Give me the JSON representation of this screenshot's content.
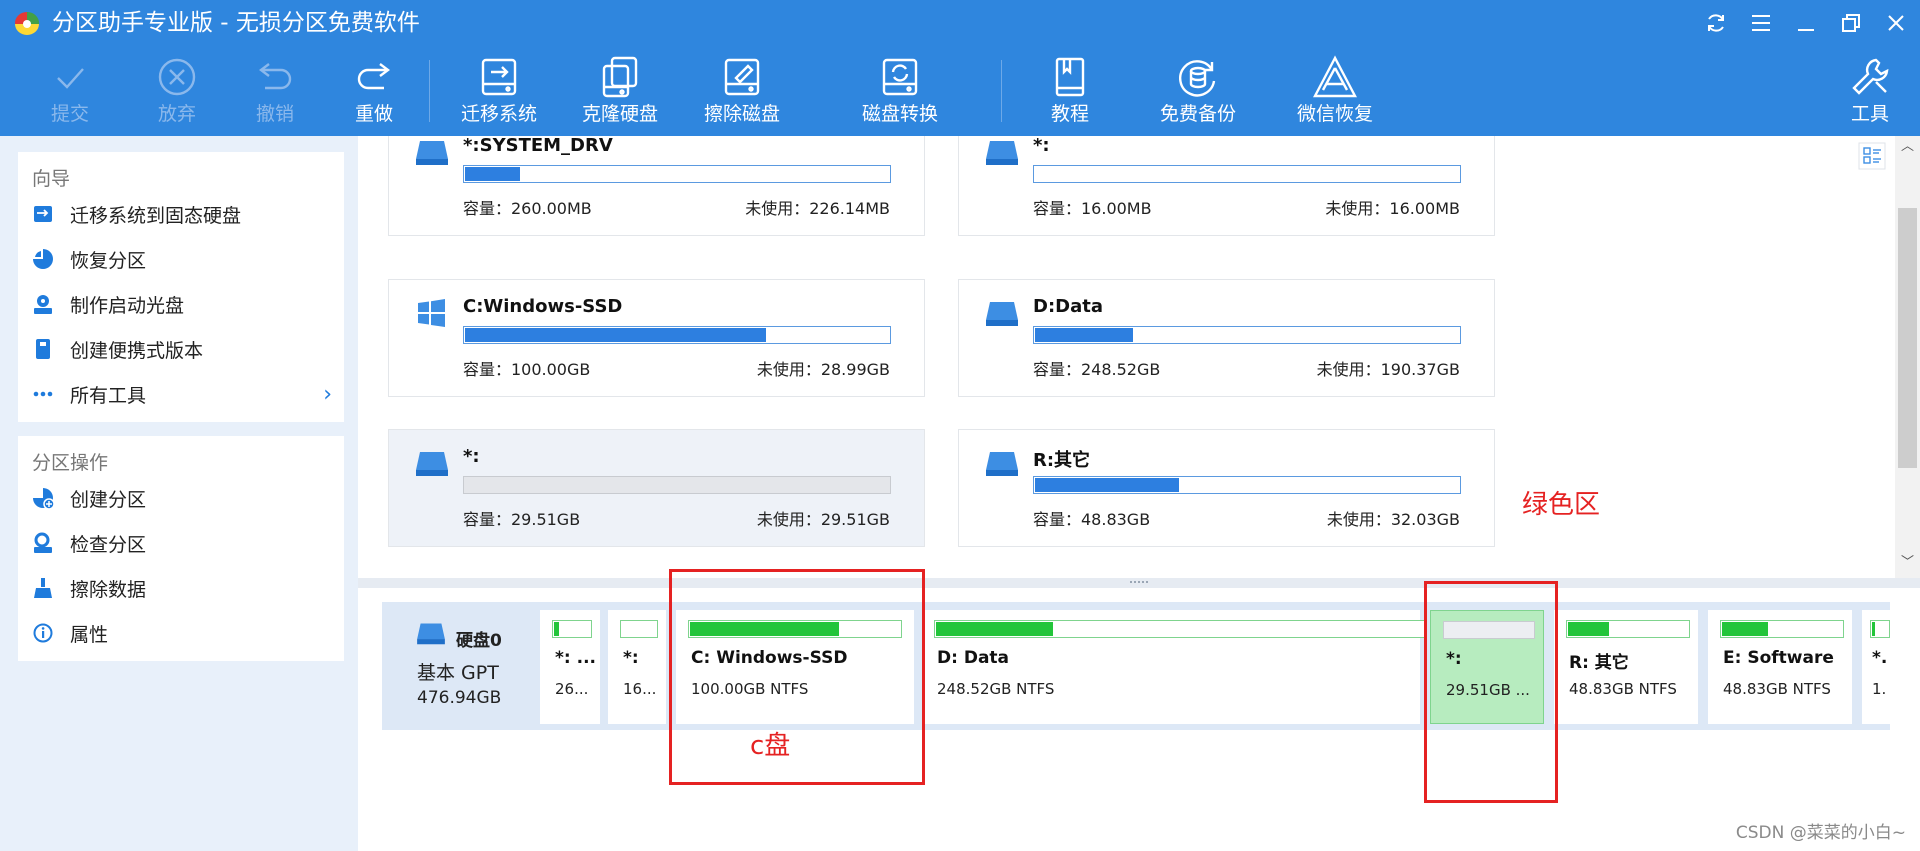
{
  "app": {
    "title": "分区助手专业版 - 无损分区免费软件"
  },
  "toolbar": {
    "commit": "提交",
    "discard": "放弃",
    "undo": "撤销",
    "redo": "重做",
    "migrate_os": "迁移系统",
    "clone_disk": "克隆硬盘",
    "wipe_disk": "擦除磁盘",
    "convert_disk": "磁盘转换",
    "tutorial": "教程",
    "free_backup": "免费备份",
    "wechat_recovery": "微信恢复",
    "tools": "工具"
  },
  "sidebar": {
    "wizard_title": "向导",
    "wizard_items": [
      "迁移系统到固态硬盘",
      "恢复分区",
      "制作启动光盘",
      "创建便携式版本",
      "所有工具"
    ],
    "ops_title": "分区操作",
    "ops_items": [
      "创建分区",
      "检查分区",
      "擦除数据",
      "属性"
    ]
  },
  "cards": [
    {
      "name": "*:SYSTEM_DRV",
      "capacity": "容量：260.00MB",
      "free": "未使用：226.14MB",
      "used_fraction": 0.13
    },
    {
      "name": "*:",
      "capacity": "容量：16.00MB",
      "free": "未使用：16.00MB",
      "used_fraction": 0.0
    },
    {
      "name": "C:Windows-SSD",
      "capacity": "容量：100.00GB",
      "free": "未使用：28.99GB",
      "used_fraction": 0.71
    },
    {
      "name": "D:Data",
      "capacity": "容量：248.52GB",
      "free": "未使用：190.37GB",
      "used_fraction": 0.23
    },
    {
      "name": "*:",
      "capacity": "容量：29.51GB",
      "free": "未使用：29.51GB",
      "used_fraction": 0.0
    },
    {
      "name": "R:其它",
      "capacity": "容量：48.83GB",
      "free": "未使用：32.03GB",
      "used_fraction": 0.34
    }
  ],
  "disk": {
    "name": "硬盘0",
    "type": "基本 GPT",
    "size": "476.94GB",
    "partitions": [
      {
        "name": "*: ...",
        "info": "26...",
        "used_fraction": 0.13
      },
      {
        "name": "*:",
        "info": "16...",
        "used_fraction": 0.0
      },
      {
        "name": "C: Windows-SSD",
        "info": "100.00GB NTFS",
        "used_fraction": 0.71
      },
      {
        "name": "D: Data",
        "info": "248.52GB NTFS",
        "used_fraction": 0.24
      },
      {
        "name": "*:",
        "info": "29.51GB ...",
        "used_fraction": 0.0
      },
      {
        "name": "R: 其它",
        "info": "48.83GB NTFS",
        "used_fraction": 0.34
      },
      {
        "name": "E: Software",
        "info": "48.83GB NTFS",
        "used_fraction": 0.38
      },
      {
        "name": "*.",
        "info": "1.",
        "used_fraction": 0.2
      }
    ]
  },
  "annotations": {
    "green_area": "绿色区",
    "c_drive": "c盘"
  },
  "watermark": "CSDN @菜菜的小白~",
  "colors": {
    "titlebar": "#2f86de",
    "used_bar": "#2d7fe0",
    "partition_used": "#22c53a",
    "annotation": "#e52222"
  }
}
